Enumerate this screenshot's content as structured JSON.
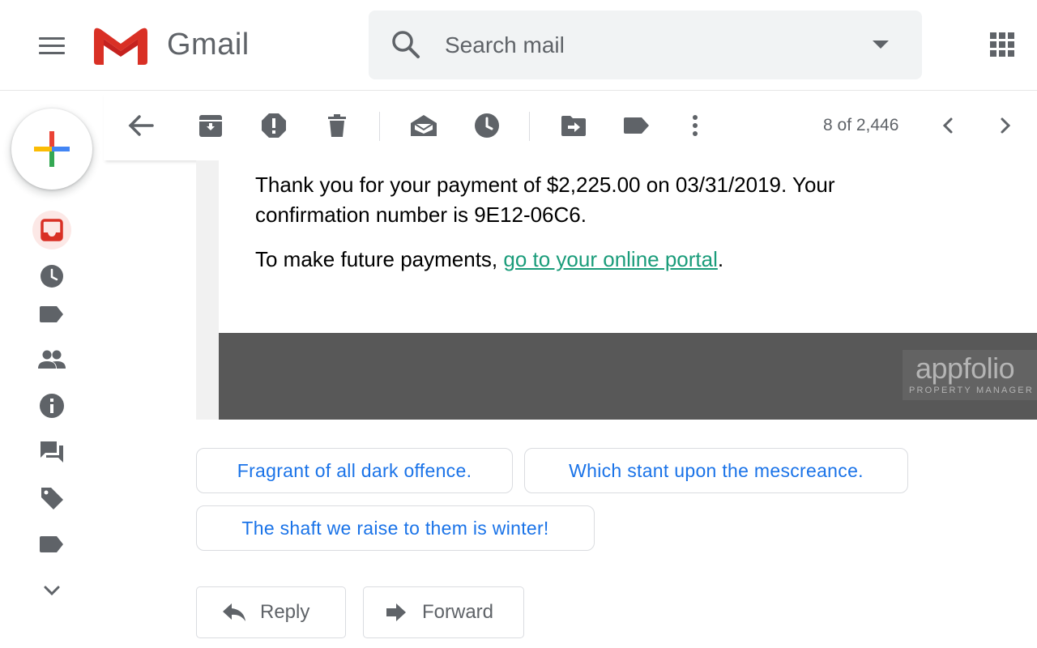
{
  "app": {
    "name": "Gmail"
  },
  "search": {
    "placeholder": "Search mail"
  },
  "toolbar": {
    "buttons": [
      "back",
      "archive",
      "report-spam",
      "delete",
      "mark-unread",
      "snooze",
      "move-to",
      "labels",
      "more"
    ],
    "pager": "8 of 2,446"
  },
  "email": {
    "line1": "Thank you for your payment of $2,225.00 on 03/31/2019. Your",
    "line2": "confirmation number is 9E12-06C6.",
    "portal_prefix": "To make future payments, ",
    "portal_link": "go to your online portal",
    "portal_suffix": ".",
    "footer_logo": "appfolio",
    "footer_sub": "PROPERTY MANAGER"
  },
  "smart_replies": [
    "Fragrant of all dark offence.",
    "Which stant upon the mescreance.",
    "The shaft we raise to them is winter!"
  ],
  "actions": {
    "reply": "Reply",
    "forward": "Forward"
  },
  "colors": {
    "accent_red": "#d93025",
    "link_teal": "#1a9c7a",
    "chip_blue": "#1a73e8",
    "icon_gray": "#5f6368"
  }
}
